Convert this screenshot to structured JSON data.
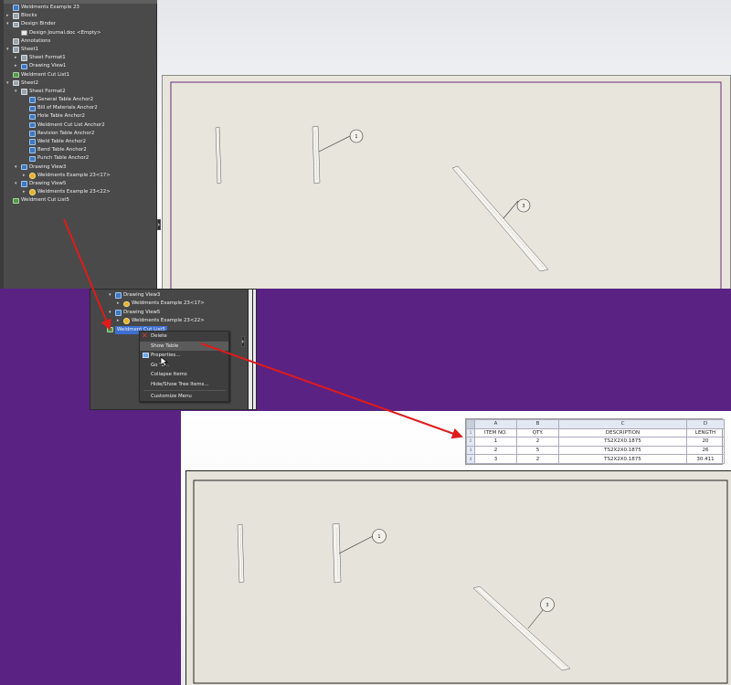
{
  "tree": {
    "items": [
      {
        "label": "Weldments Example 23",
        "icon": "part-icon",
        "indent": 0,
        "arrow": ""
      },
      {
        "label": "Blocks",
        "icon": "blocks-icon",
        "indent": 0,
        "arrow": "▸"
      },
      {
        "label": "Design Binder",
        "icon": "binder-icon",
        "indent": 0,
        "arrow": "▾"
      },
      {
        "label": "Design Journal.doc <Empty>",
        "icon": "doc-icon",
        "indent": 1,
        "arrow": ""
      },
      {
        "label": "Annotations",
        "icon": "annotations-icon",
        "indent": 0,
        "arrow": ""
      },
      {
        "label": "Sheet1",
        "icon": "sheet-icon",
        "indent": 0,
        "arrow": "▾"
      },
      {
        "label": "Sheet Format1",
        "icon": "sheet-format-icon",
        "indent": 1,
        "arrow": "▸"
      },
      {
        "label": "Drawing View1",
        "icon": "drawing-view-icon",
        "indent": 1,
        "arrow": "▸"
      },
      {
        "label": "Weldment Cut List1",
        "icon": "cut-list-icon",
        "indent": 0,
        "arrow": ""
      },
      {
        "label": "Sheet2",
        "icon": "sheet-icon",
        "indent": 0,
        "arrow": "▾"
      },
      {
        "label": "Sheet Format2",
        "icon": "sheet-format-icon",
        "indent": 1,
        "arrow": "▾"
      },
      {
        "label": "General Table Anchor2",
        "icon": "table-anchor-icon",
        "indent": 2,
        "arrow": ""
      },
      {
        "label": "Bill of Materials Anchor2",
        "icon": "table-anchor-icon",
        "indent": 2,
        "arrow": ""
      },
      {
        "label": "Hole Table Anchor2",
        "icon": "table-anchor-icon",
        "indent": 2,
        "arrow": ""
      },
      {
        "label": "Weldment Cut List Anchor2",
        "icon": "table-anchor-icon",
        "indent": 2,
        "arrow": ""
      },
      {
        "label": "Revision Table Anchor2",
        "icon": "table-anchor-icon",
        "indent": 2,
        "arrow": ""
      },
      {
        "label": "Weld Table Anchor2",
        "icon": "table-anchor-icon",
        "indent": 2,
        "arrow": ""
      },
      {
        "label": "Bend Table Anchor2",
        "icon": "table-anchor-icon",
        "indent": 2,
        "arrow": ""
      },
      {
        "label": "Punch Table Anchor2",
        "icon": "table-anchor-icon",
        "indent": 2,
        "arrow": ""
      },
      {
        "label": "Drawing View3",
        "icon": "drawing-view-icon",
        "indent": 1,
        "arrow": "▾"
      },
      {
        "label": "Weldments Example 23<17>",
        "icon": "weldment-part-icon",
        "indent": 2,
        "arrow": "▸"
      },
      {
        "label": "Drawing View5",
        "icon": "drawing-view-icon",
        "indent": 1,
        "arrow": "▾"
      },
      {
        "label": "Weldments Example 23<22>",
        "icon": "weldment-part-icon",
        "indent": 2,
        "arrow": "▸"
      },
      {
        "label": "Weldment Cut List5",
        "icon": "cut-list-icon",
        "indent": 0,
        "arrow": ""
      }
    ]
  },
  "mid": {
    "items": [
      {
        "label": "Drawing View3",
        "icon": "drawing-view-icon",
        "arrow": "▾",
        "indent": 1
      },
      {
        "label": "Weldments Example 23<17>",
        "icon": "weldment-part-icon",
        "arrow": "▸",
        "indent": 2
      },
      {
        "label": "Drawing View5",
        "icon": "drawing-view-icon",
        "arrow": "▾",
        "indent": 1
      },
      {
        "label": "Weldments Example 23<22>",
        "icon": "weldment-part-icon",
        "arrow": "▸",
        "indent": 2
      },
      {
        "label": "Weldment Cut List5",
        "icon": "cut-list-icon",
        "arrow": "",
        "indent": 0
      }
    ]
  },
  "context_menu": {
    "delete": "Delete",
    "show_table": "Show Table",
    "properties": "Properties...",
    "go_to": "Go To...",
    "collapse": "Collapse Items",
    "hide_show": "Hide/Show Tree Items...",
    "customize": "Customize Menu"
  },
  "balloons": {
    "top": [
      "1",
      "3"
    ],
    "bottom": [
      "1",
      "3"
    ]
  },
  "bom": {
    "col_letters": [
      "A",
      "B",
      "C",
      "D"
    ],
    "headers": [
      "ITEM NO.",
      "QTY.",
      "DESCRIPTION",
      "LENGTH"
    ],
    "row_nums": [
      "1",
      "2",
      "3",
      "4"
    ],
    "rows": [
      [
        "1",
        "2",
        "TS2X2X0.1875",
        "20"
      ],
      [
        "2",
        "5",
        "TS2X2X0.1875",
        "26"
      ],
      [
        "3",
        "2",
        "TS2X2X0.1875",
        "30.411"
      ]
    ]
  },
  "colors": {
    "tree_bg": "#4a4a4a",
    "selection": "#3d6fd1",
    "sheet_frame": "#6b2b7a",
    "callout_arrow": "#e01b1b",
    "background": "#5a2283"
  }
}
